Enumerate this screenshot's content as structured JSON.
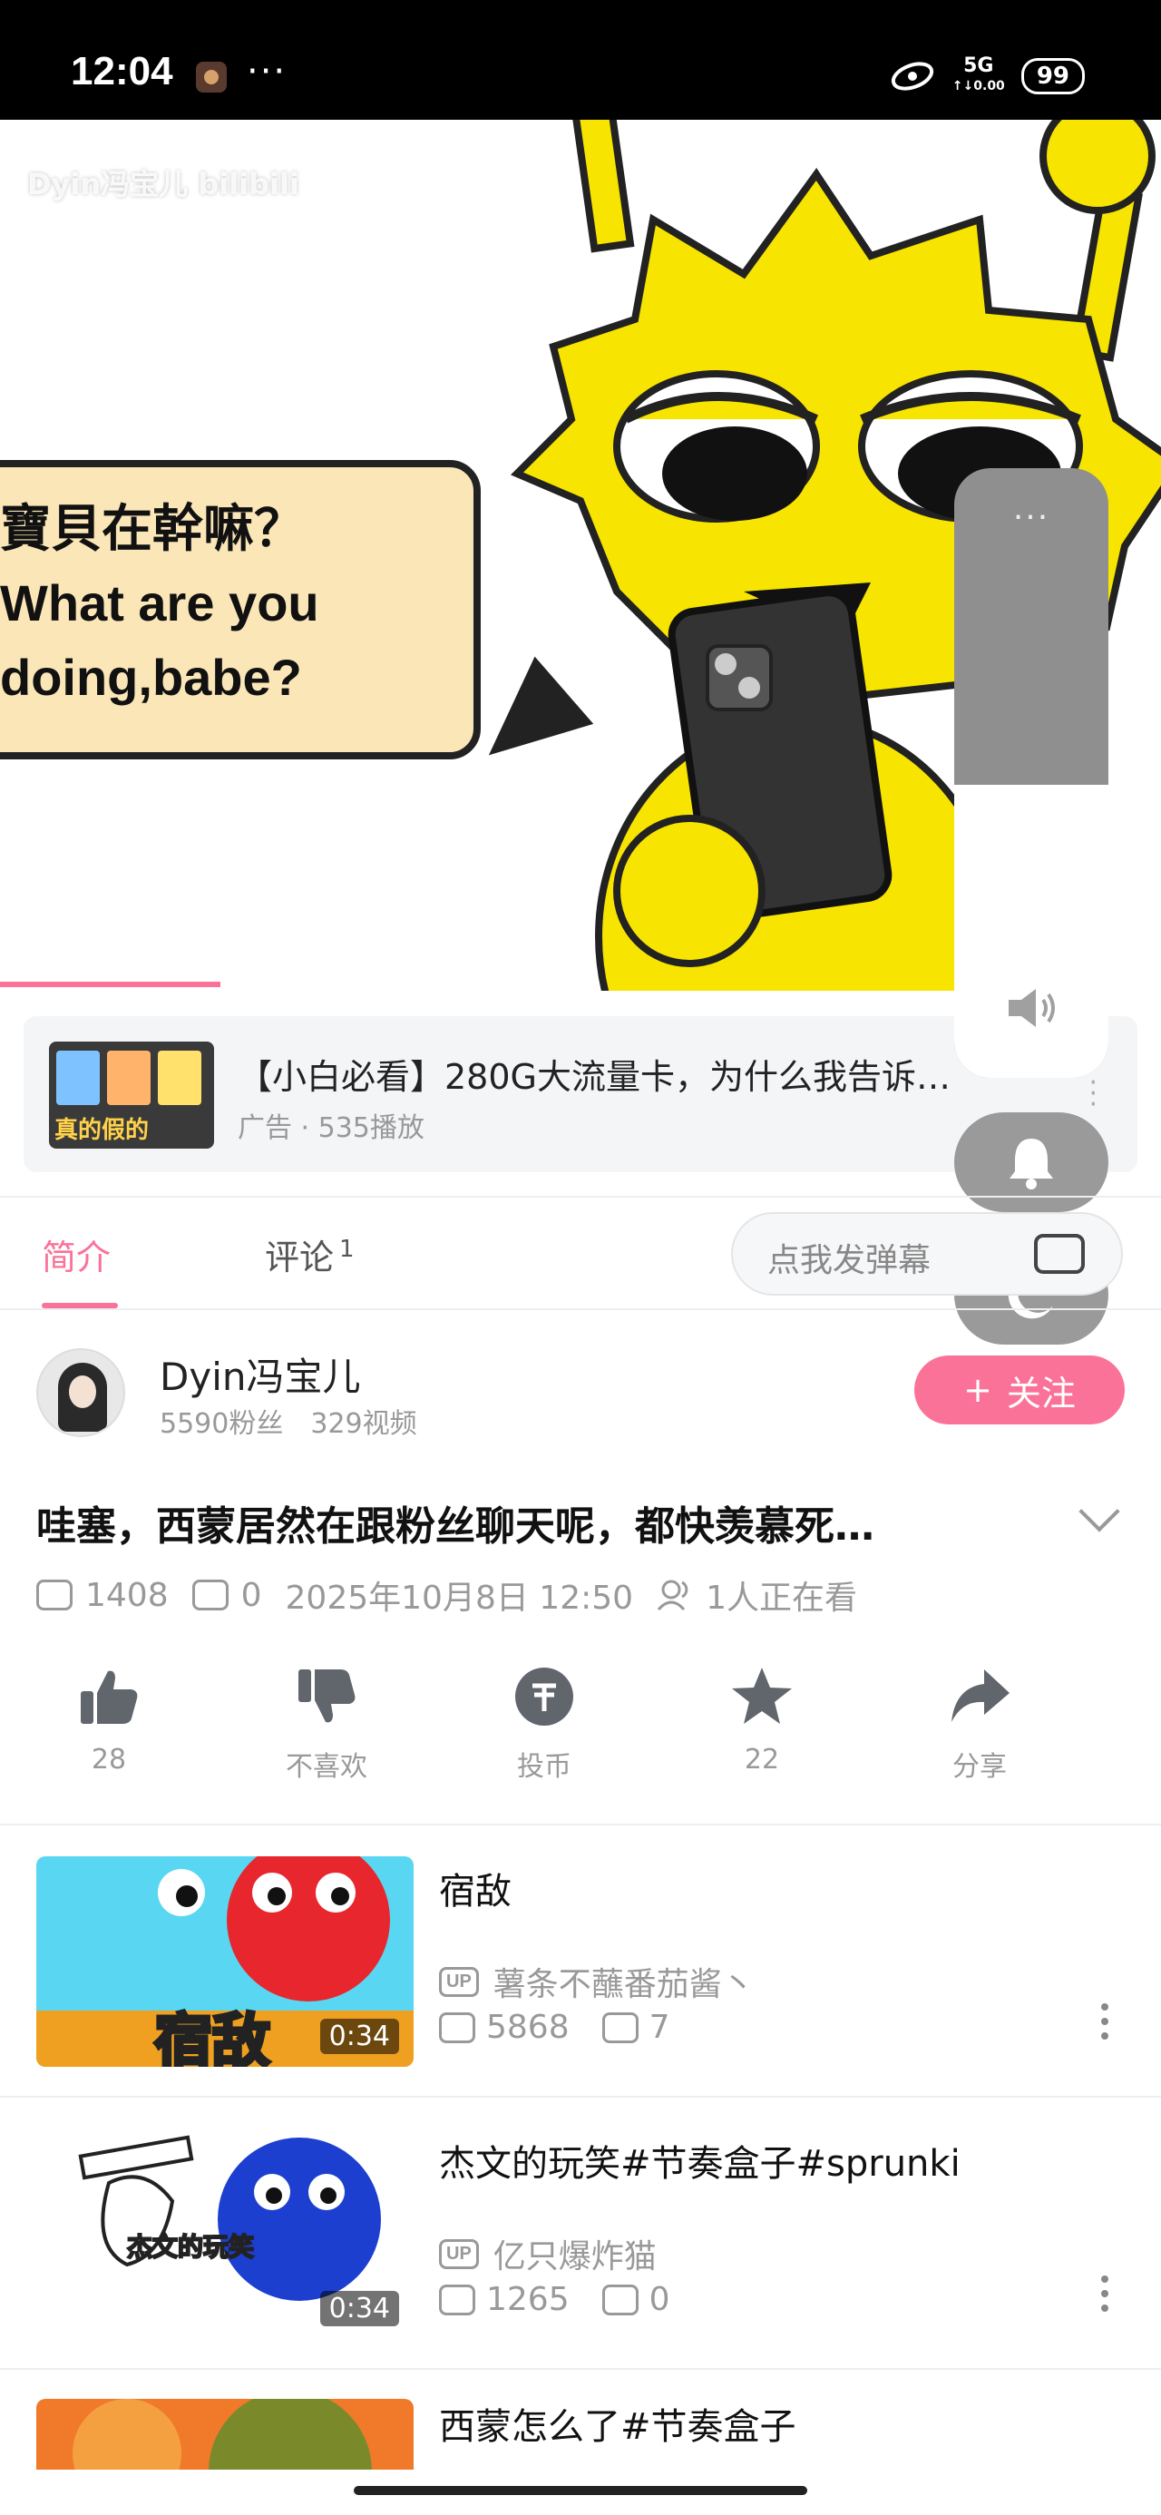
{
  "status_bar": {
    "time": "12:04",
    "dots": "···",
    "network": "5G",
    "network_sub": "↑↓0.00",
    "battery": "99"
  },
  "video": {
    "watermark": "Dyin冯宝儿 bilibili",
    "bubble_line1": "寶貝在幹嘛？",
    "bubble_line2": "What are you",
    "bubble_line3": "doing,babe?",
    "progress_fraction": 0.19,
    "volume_fraction": 0.48
  },
  "overlay": {
    "more": "···"
  },
  "ad": {
    "title": "【小白必看】280G大流量卡，为什么我告诉…",
    "meta": "广告 · 535播放",
    "thumb_label": "真的假的"
  },
  "tabs": {
    "intro": "简介",
    "comments": "评论",
    "comments_count": "1"
  },
  "danmaku": {
    "placeholder": "点我发弹幕"
  },
  "uploader": {
    "name": "Dyin冯宝儿",
    "fans": "5590粉丝",
    "videos": "329视频",
    "follow": "关注",
    "follow_icon": "+"
  },
  "video_info": {
    "title": "哇塞，西蒙居然在跟粉丝聊天呢，都快羡慕死…",
    "plays": "1408",
    "danmaku": "0",
    "date": "2025年10月8日 12:50",
    "watching": "1人正在看"
  },
  "actions": [
    {
      "icon": "thumbs-up-icon",
      "label": "28"
    },
    {
      "icon": "thumbs-down-icon",
      "label": "不喜欢"
    },
    {
      "icon": "coin-icon",
      "label": "投币"
    },
    {
      "icon": "star-icon",
      "label": "22"
    },
    {
      "icon": "share-icon",
      "label": "分享"
    }
  ],
  "recommendations": [
    {
      "title": "宿敌",
      "up_tag": "UP",
      "up": "薯条不蘸番茄酱丶",
      "plays": "5868",
      "danmaku": "7",
      "duration": "0:34",
      "thumb_text": "宿敌"
    },
    {
      "title": "杰文的玩笑#节奏盒子#sprunki",
      "up_tag": "UP",
      "up": "亿只爆炸猫",
      "plays": "1265",
      "danmaku": "0",
      "duration": "0:34",
      "thumb_text": "杰文的玩笑"
    },
    {
      "title": "西蒙怎么了#节奏盒子"
    }
  ],
  "colors": {
    "accent": "#fb7299",
    "video_yellow": "#f7e400",
    "muted": "#999999"
  }
}
